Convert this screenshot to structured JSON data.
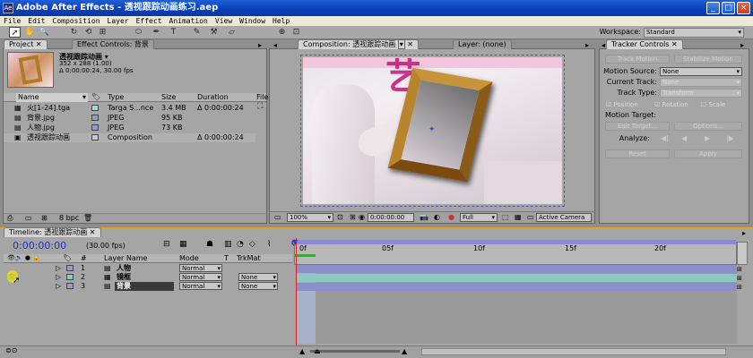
{
  "window": {
    "title": "Adobe After Effects - 透视跟踪动画练习.aep",
    "buttons": [
      "_",
      "□",
      "×"
    ]
  },
  "menu": [
    "File",
    "Edit",
    "Composition",
    "Layer",
    "Effect",
    "Animation",
    "View",
    "Window",
    "Help"
  ],
  "toolbar": {
    "tools": [
      "selection-tool",
      "hand-tool",
      "zoom-tool",
      "rotate-tool",
      "orbit-camera-tool",
      "pan-behind-tool",
      "mask-tool",
      "pen-tool",
      "type-tool",
      "brush-tool",
      "clone-tool",
      "eraser-tool"
    ],
    "workspace_label": "Workspace:",
    "workspace_value": "Standard"
  },
  "project": {
    "tab": "Project",
    "tab2": "Effect Controls: 背景",
    "comp_name": "透视跟踪动画 ▾",
    "comp_size": "352 x 288 (1.00)",
    "comp_duration": "Δ 0:00:00:24, 30.00 fps",
    "columns": [
      "Name",
      "Type",
      "Size",
      "Duration",
      "File"
    ],
    "items": [
      {
        "name": "火[1-24].tga",
        "type": "Targa S...nce",
        "size": "3.4 MB",
        "duration": "Δ 0:00:00:24",
        "color": "#a8d8d0"
      },
      {
        "name": "背景.jpg",
        "type": "JPEG",
        "size": "95 KB",
        "duration": "",
        "color": "#9999cc"
      },
      {
        "name": "人物.jpg",
        "type": "JPEG",
        "size": "73 KB",
        "duration": "",
        "color": "#9999cc"
      },
      {
        "name": "透视跟踪动画",
        "type": "Composition",
        "size": "",
        "duration": "Δ 0:00:00:24",
        "color": "#c8c8c8"
      }
    ],
    "bpc": "8 bpc"
  },
  "composition": {
    "tab": "Composition: 透视跟踪动画",
    "layer_tab": "Layer: (none)",
    "magnification": "100%",
    "timecode": "0:00:00:00",
    "resolution": "Full",
    "view": "Active Camera",
    "overlay_text": "艺"
  },
  "tracker": {
    "tab": "Tracker Controls",
    "track_motion": "Track Motion",
    "stabilize_motion": "Stabilize Motion",
    "motion_source_label": "Motion Source:",
    "motion_source": "None",
    "current_track_label": "Current Track:",
    "current_track": "None",
    "track_type_label": "Track Type:",
    "track_type": "Transform",
    "position": "Position",
    "rotation": "Rotation",
    "scale": "Scale",
    "motion_target_label": "Motion Target:",
    "edit_target": "Edit Target...",
    "options": "Options...",
    "analyze_label": "Analyze:",
    "reset": "Reset",
    "apply": "Apply"
  },
  "timeline": {
    "tab": "Timeline: 透视跟踪动画",
    "timecode": "0:00:00:00",
    "fps": "(30.00 fps)",
    "columns": {
      "num": "#",
      "layer_name": "Layer Name",
      "mode": "Mode",
      "t": "T",
      "trkmat": "TrkMat"
    },
    "ruler": [
      "0f",
      "05f",
      "10f",
      "15f",
      "20f"
    ],
    "layers": [
      {
        "num": "1",
        "name": "人物",
        "mode": "Normal",
        "trkmat": ""
      },
      {
        "num": "2",
        "name": "镜框",
        "mode": "Normal",
        "trkmat": "None"
      },
      {
        "num": "3",
        "name": "背景",
        "mode": "Normal",
        "trkmat": "None"
      }
    ],
    "track_colors": [
      "#8a8fc8",
      "#8ec8c0",
      "#8a8fc8"
    ]
  }
}
